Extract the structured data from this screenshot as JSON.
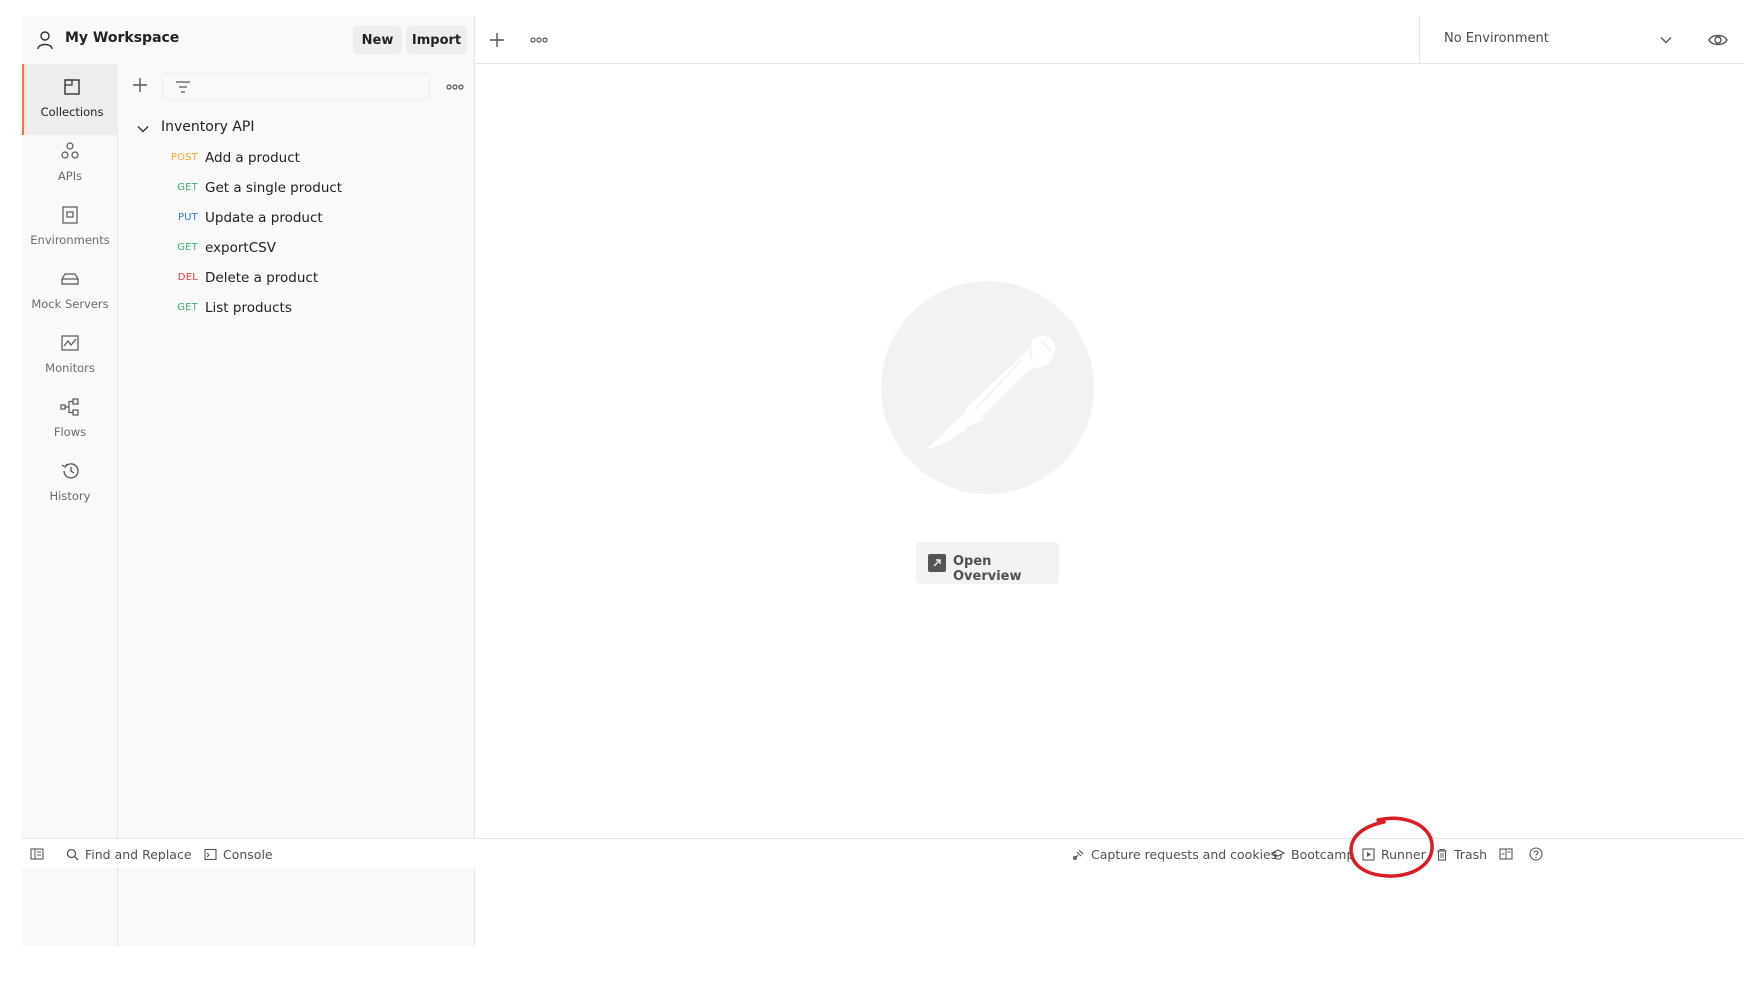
{
  "workspace": {
    "title": "My Workspace",
    "new_label": "New",
    "import_label": "Import"
  },
  "environment": {
    "selected": "No Environment"
  },
  "rail": [
    {
      "label": "Collections",
      "icon": "collections-icon",
      "active": true
    },
    {
      "label": "APIs",
      "icon": "apis-icon",
      "active": false
    },
    {
      "label": "Environments",
      "icon": "environments-icon",
      "active": false
    },
    {
      "label": "Mock Servers",
      "icon": "mock-servers-icon",
      "active": false
    },
    {
      "label": "Monitors",
      "icon": "monitors-icon",
      "active": false
    },
    {
      "label": "Flows",
      "icon": "flows-icon",
      "active": false
    },
    {
      "label": "History",
      "icon": "history-icon",
      "active": false
    }
  ],
  "sidebar": {
    "search_placeholder": "",
    "collection": {
      "name": "Inventory API",
      "requests": [
        {
          "method": "POST",
          "name": "Add a product",
          "color": "#f5a623"
        },
        {
          "method": "GET",
          "name": "Get a single product",
          "color": "#3bb26c"
        },
        {
          "method": "PUT",
          "name": "Update a product",
          "color": "#2b7bde"
        },
        {
          "method": "GET",
          "name": "exportCSV",
          "color": "#3bb26c"
        },
        {
          "method": "DEL",
          "name": "Delete a product",
          "color": "#dd3a2c"
        },
        {
          "method": "GET",
          "name": "List products",
          "color": "#3bb26c"
        }
      ]
    }
  },
  "main": {
    "open_overview_label": "Open Overview"
  },
  "statusbar": {
    "find_replace": "Find and Replace",
    "console": "Console",
    "capture": "Capture requests and cookies",
    "bootcamp": "Bootcamp",
    "runner": "Runner",
    "trash": "Trash"
  },
  "colors": {
    "accent": "#ff6c37",
    "annotation": "#d91c26"
  }
}
